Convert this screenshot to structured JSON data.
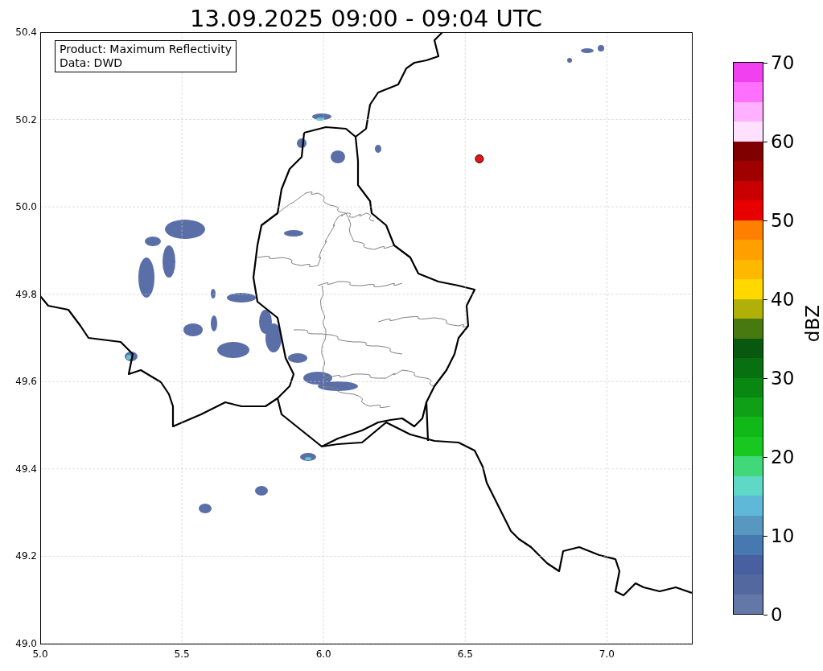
{
  "title": "13.09.2025 09:00 - 09:04 UTC",
  "map": {
    "info_box": [
      "Product: Maximum Reflectivity",
      "Data: DWD"
    ],
    "chart_data": {
      "type": "scatter",
      "xlim": [
        5.0,
        7.3
      ],
      "ylim": [
        49.0,
        50.4
      ],
      "xticks": [
        {
          "value": 5,
          "label": "5.0"
        },
        {
          "value": 5.5,
          "label": "5.5"
        },
        {
          "value": 6,
          "label": "6.0"
        },
        {
          "value": 6.5,
          "label": "6.5"
        },
        {
          "value": 7,
          "label": "7.0"
        }
      ],
      "yticks": [
        {
          "value": 49,
          "label": "49.0"
        },
        {
          "value": 49.2,
          "label": "49.2"
        },
        {
          "value": 49.4,
          "label": "49.4"
        },
        {
          "value": 49.6,
          "label": "49.6"
        },
        {
          "value": 49.8,
          "label": "49.8"
        },
        {
          "value": 50,
          "label": "50.0"
        },
        {
          "value": 50.2,
          "label": "50.2"
        },
        {
          "value": 50.4,
          "label": "50.4"
        }
      ],
      "grid": true,
      "x": [
        6.55
      ],
      "series": [
        {
          "color": "#ee1111",
          "values": [
            50.11
          ]
        }
      ]
    }
  },
  "colorbar": {
    "label": "dBZ",
    "ticks": [
      "70",
      "60",
      "50",
      "40",
      "30",
      "20",
      "10",
      "0"
    ],
    "bands": [
      {
        "color": "#f040f0"
      },
      {
        "color": "#ff70ff"
      },
      {
        "color": "#ffb0ff"
      },
      {
        "color": "#ffe0ff"
      },
      {
        "color": "#800000"
      },
      {
        "color": "#a00000"
      },
      {
        "color": "#c80000"
      },
      {
        "color": "#e80000"
      },
      {
        "color": "#ff8000"
      },
      {
        "color": "#ffa000"
      },
      {
        "color": "#ffb800"
      },
      {
        "color": "#ffd800"
      },
      {
        "color": "#b0b008"
      },
      {
        "color": "#487810"
      },
      {
        "color": "#085810"
      },
      {
        "color": "#087010"
      },
      {
        "color": "#088810"
      },
      {
        "color": "#10a018"
      },
      {
        "color": "#10b818"
      },
      {
        "color": "#18c820"
      },
      {
        "color": "#40d878"
      },
      {
        "color": "#60d8c8"
      },
      {
        "color": "#60b8d8"
      },
      {
        "color": "#5898c0"
      },
      {
        "color": "#4878b0"
      },
      {
        "color": "#4860a0"
      },
      {
        "color": "#5468a0"
      },
      {
        "color": "#6478a8"
      }
    ]
  }
}
